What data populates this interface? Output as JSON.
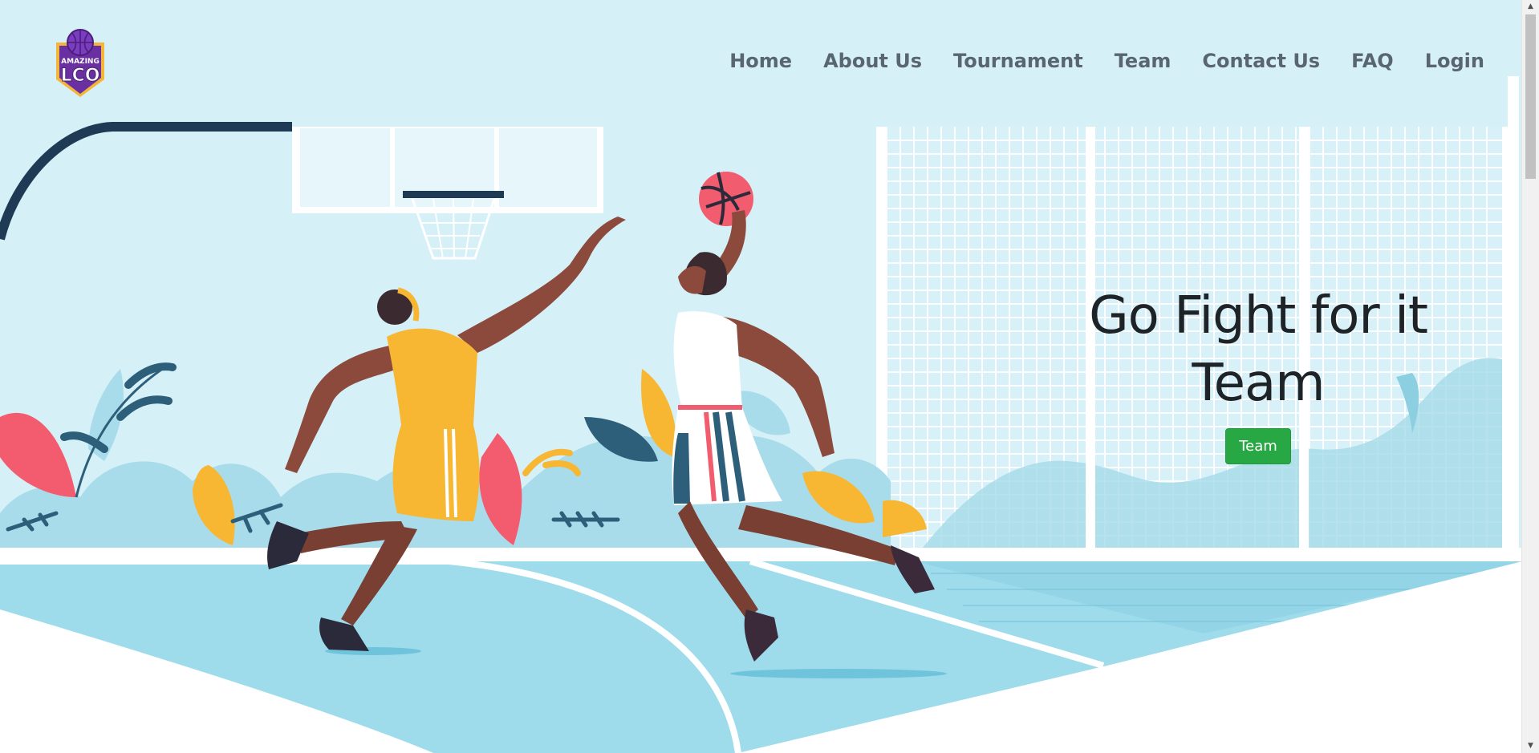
{
  "brand": {
    "logo_top": "AMAZING",
    "logo_main": "LCO",
    "colors": {
      "purple": "#6a2fa0",
      "gold": "#f4b638",
      "sky": "#d6f0f7"
    }
  },
  "nav": {
    "items": [
      {
        "label": "Home"
      },
      {
        "label": "About Us"
      },
      {
        "label": "Tournament"
      },
      {
        "label": "Team"
      },
      {
        "label": "Contact Us"
      },
      {
        "label": "FAQ"
      },
      {
        "label": "Login"
      }
    ]
  },
  "hero": {
    "title_line1": "Go Fight for it",
    "title_line2": "Team",
    "button_label": "Team",
    "button_color": "#28a745"
  },
  "scrollbar": {
    "up_icon": "arrow-up-icon",
    "down_icon": "arrow-down-icon"
  }
}
